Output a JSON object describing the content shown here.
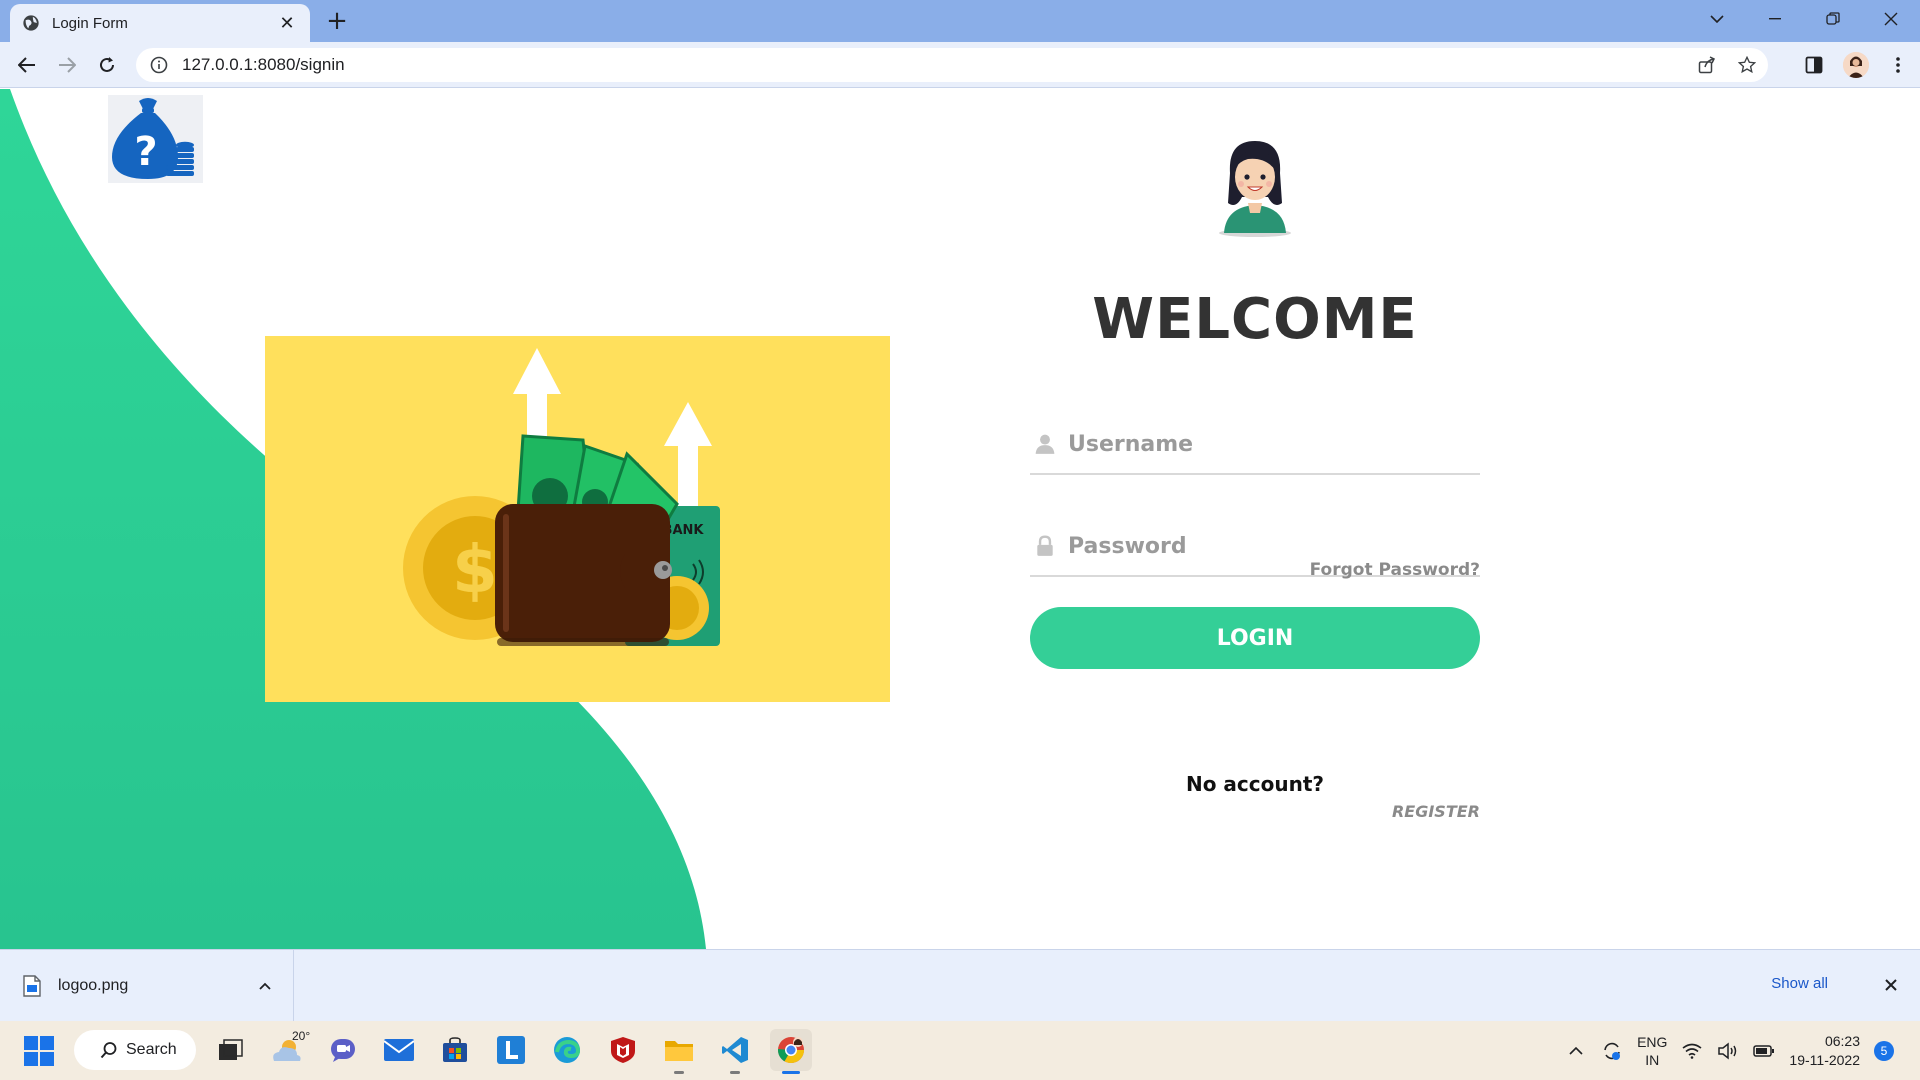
{
  "browser": {
    "tab_title": "Login Form",
    "url": "127.0.0.1:8080/signin"
  },
  "page": {
    "welcome": "WELCOME",
    "username_placeholder": "Username",
    "password_placeholder": "Password",
    "forgot_password": "Forgot Password?",
    "login_button": "LOGIN",
    "no_account": "No account?",
    "register": "REGISTER",
    "accent_color": "#34cf97",
    "hero_background": "#ffe05c"
  },
  "download_bar": {
    "file_name": "logoo.png",
    "show_all": "Show all"
  },
  "taskbar": {
    "search_label": "Search",
    "weather_temp": "20°",
    "language": "ENG",
    "region": "IN",
    "time": "06:23",
    "date": "19-11-2022",
    "notification_count": "5"
  }
}
